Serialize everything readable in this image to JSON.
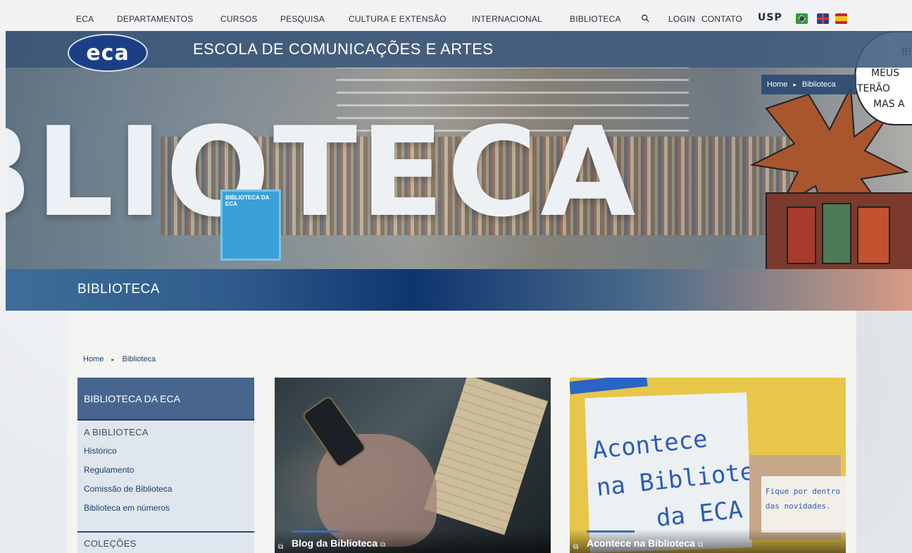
{
  "nav": {
    "items": [
      "ECA",
      "DEPARTAMENTOS",
      "CURSOS",
      "PESQUISA",
      "CULTURA E EXTENSÃO",
      "INTERNACIONAL",
      "BIBLIOTECA"
    ],
    "search_icon": "⚲",
    "login": "LOGIN",
    "contact": "CONTATO",
    "usp_logo": "USP",
    "flags": [
      "brazil-flag",
      "uk-flag",
      "spain-flag"
    ]
  },
  "header": {
    "logo": "eca",
    "site_title": "ESCOLA DE COMUNICAÇÕES E ARTES"
  },
  "hero": {
    "big_word": "BLIOTECA",
    "poster_text": "BIBLIOTECA DA ECA",
    "speech_lines": [
      "BI",
      "MEUS",
      "TERÃO",
      "MAS A"
    ],
    "breadcrumb": {
      "home": "Home",
      "current": "Biblioteca"
    },
    "section_title": "BIBLIOTECA"
  },
  "breadcrumb": {
    "home": "Home",
    "current": "Biblioteca"
  },
  "sidenav": {
    "title": "BIBLIOTECA DA ECA",
    "group1": "A BIBLIOTECA",
    "links": [
      "Histórico",
      "Regulamento",
      "Comissão de Biblioteca",
      "Biblioteca em números"
    ],
    "group2": "COLEÇÕES"
  },
  "cards": [
    {
      "label": "Blog da Biblioteca",
      "ext_icon": "⧉"
    },
    {
      "label": "Acontece na Biblioteca",
      "ext_icon": "⧉",
      "note_lines": [
        "Acontece",
        "na Biblioteca",
        "da ECA"
      ],
      "sticky_lines": [
        "Fique por dentro",
        "das novidades."
      ]
    }
  ],
  "colors": {
    "header_band": "#3a5678",
    "logo_bg": "#1b3f86",
    "sidenav_head": "#48658f",
    "link": "#1e3f6e",
    "accent_bar": "#3d6fb0"
  }
}
